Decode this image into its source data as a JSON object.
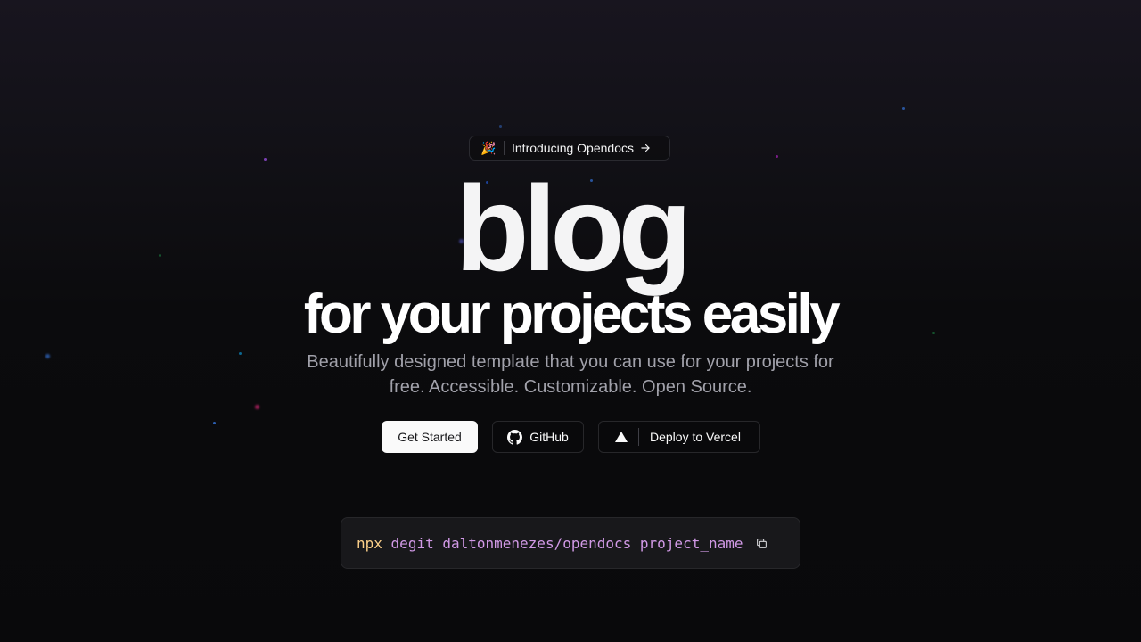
{
  "announcement": {
    "emoji": "🎉",
    "label": "Introducing Opendocs",
    "arrow_icon": "arrow-right-icon"
  },
  "hero": {
    "title": "blog",
    "subtitle_heading": "for your projects easily",
    "description": "Beautifully designed template that you can use for your projects for free. Accessible. Customizable. Open Source."
  },
  "actions": {
    "get_started": "Get Started",
    "github": "GitHub",
    "github_icon": "github-icon",
    "deploy": "Deploy to Vercel",
    "deploy_icon": "vercel-triangle-icon"
  },
  "install": {
    "command": "npx",
    "args": "degit daltonmenezes/opendocs project_name",
    "copy_icon": "copy-icon"
  },
  "colors": {
    "background": "#09090b",
    "primary_button": "#fafafa",
    "code_command": "#fbcf89",
    "code_args": "#d199e6"
  }
}
